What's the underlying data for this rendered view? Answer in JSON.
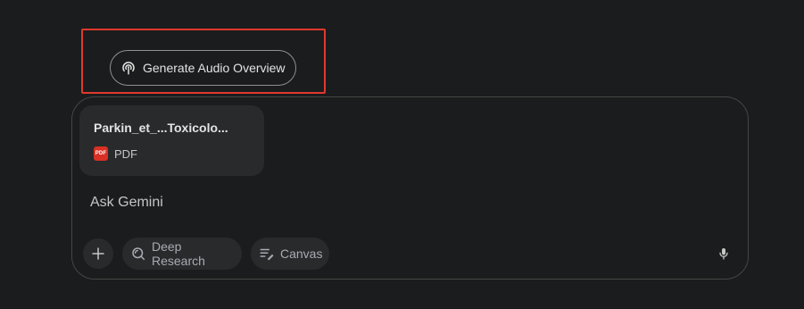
{
  "audio_overview": {
    "label": "Generate Audio Overview",
    "icon": "podcast-icon"
  },
  "attachment": {
    "file_name": "Parkin_et_...Toxicolo...",
    "file_type": "PDF",
    "badge_text": "PDF",
    "badge_color": "#d93025"
  },
  "composer": {
    "placeholder": "Ask Gemini"
  },
  "toolbar": {
    "add_icon": "plus-icon",
    "deep_research_label": "Deep Research",
    "deep_research_icon": "deep-research-icon",
    "canvas_label": "Canvas",
    "canvas_icon": "canvas-icon",
    "mic_icon": "microphone-icon"
  },
  "colors": {
    "background": "#1b1c1d",
    "highlight": "#e0382d",
    "chip_bg": "#282a2c"
  }
}
